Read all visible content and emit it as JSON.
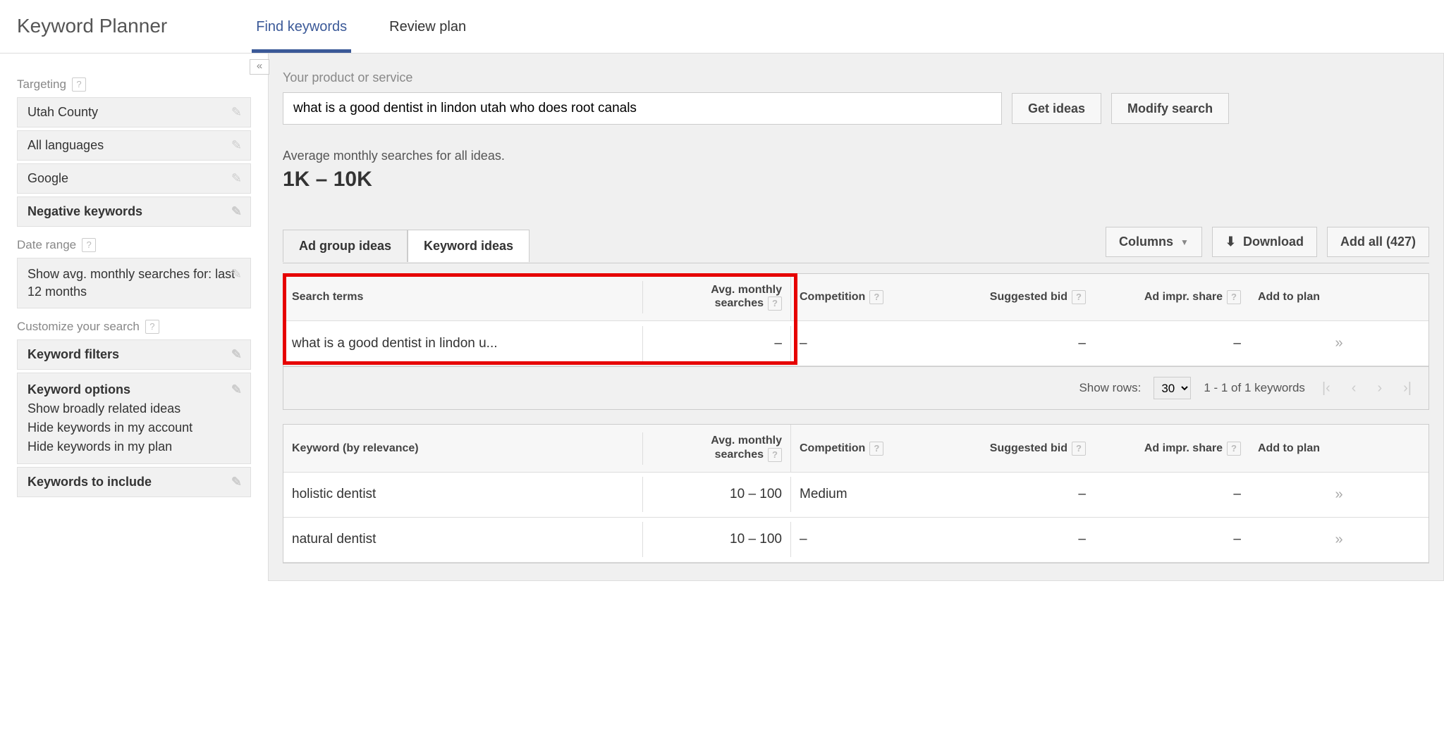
{
  "header": {
    "title": "Keyword Planner",
    "tabs": [
      {
        "label": "Find keywords",
        "active": true
      },
      {
        "label": "Review plan",
        "active": false
      }
    ]
  },
  "sidebar": {
    "targeting_label": "Targeting",
    "targeting": [
      {
        "label": "Utah County",
        "bold": false
      },
      {
        "label": "All languages",
        "bold": false
      },
      {
        "label": "Google",
        "bold": false
      },
      {
        "label": "Negative keywords",
        "bold": true
      }
    ],
    "daterange_label": "Date range",
    "daterange_text": "Show avg. monthly searches for: last 12 months",
    "customize_label": "Customize your search",
    "customize": [
      {
        "label": "Keyword filters",
        "sub": []
      },
      {
        "label": "Keyword options",
        "sub": [
          "Show broadly related ideas",
          "Hide keywords in my account",
          "Hide keywords in my plan"
        ]
      },
      {
        "label": "Keywords to include",
        "sub": []
      }
    ]
  },
  "main": {
    "prompt": "Your product or service",
    "search_value": "what is a good dentist in lindon utah who does root canals",
    "get_ideas": "Get ideas",
    "modify_search": "Modify search",
    "metric_label": "Average monthly searches for all ideas.",
    "metric_value": "1K – 10K",
    "tabs": [
      {
        "label": "Ad group ideas",
        "active": false
      },
      {
        "label": "Keyword ideas",
        "active": true
      }
    ],
    "btn_columns": "Columns",
    "btn_download": "Download",
    "btn_addall": "Add all (427)"
  },
  "table1": {
    "headers": {
      "term": "Search terms",
      "avg1": "Avg. monthly",
      "avg2": "searches",
      "comp": "Competition",
      "bid": "Suggested bid",
      "impr": "Ad impr. share",
      "add": "Add to plan"
    },
    "rows": [
      {
        "term": "what is a good dentist in lindon u...",
        "avg": "–",
        "comp": "–",
        "bid": "–",
        "impr": "–",
        "add": "»"
      }
    ]
  },
  "pager": {
    "show_rows": "Show rows:",
    "rows_value": "30",
    "range": "1 - 1 of 1 keywords"
  },
  "table2": {
    "headers": {
      "term": "Keyword (by relevance)",
      "avg1": "Avg. monthly",
      "avg2": "searches",
      "comp": "Competition",
      "bid": "Suggested bid",
      "impr": "Ad impr. share",
      "add": "Add to plan"
    },
    "rows": [
      {
        "term": "holistic dentist",
        "avg": "10 – 100",
        "comp": "Medium",
        "bid": "–",
        "impr": "–",
        "add": "»"
      },
      {
        "term": "natural dentist",
        "avg": "10 – 100",
        "comp": "–",
        "bid": "–",
        "impr": "–",
        "add": "»"
      }
    ]
  }
}
